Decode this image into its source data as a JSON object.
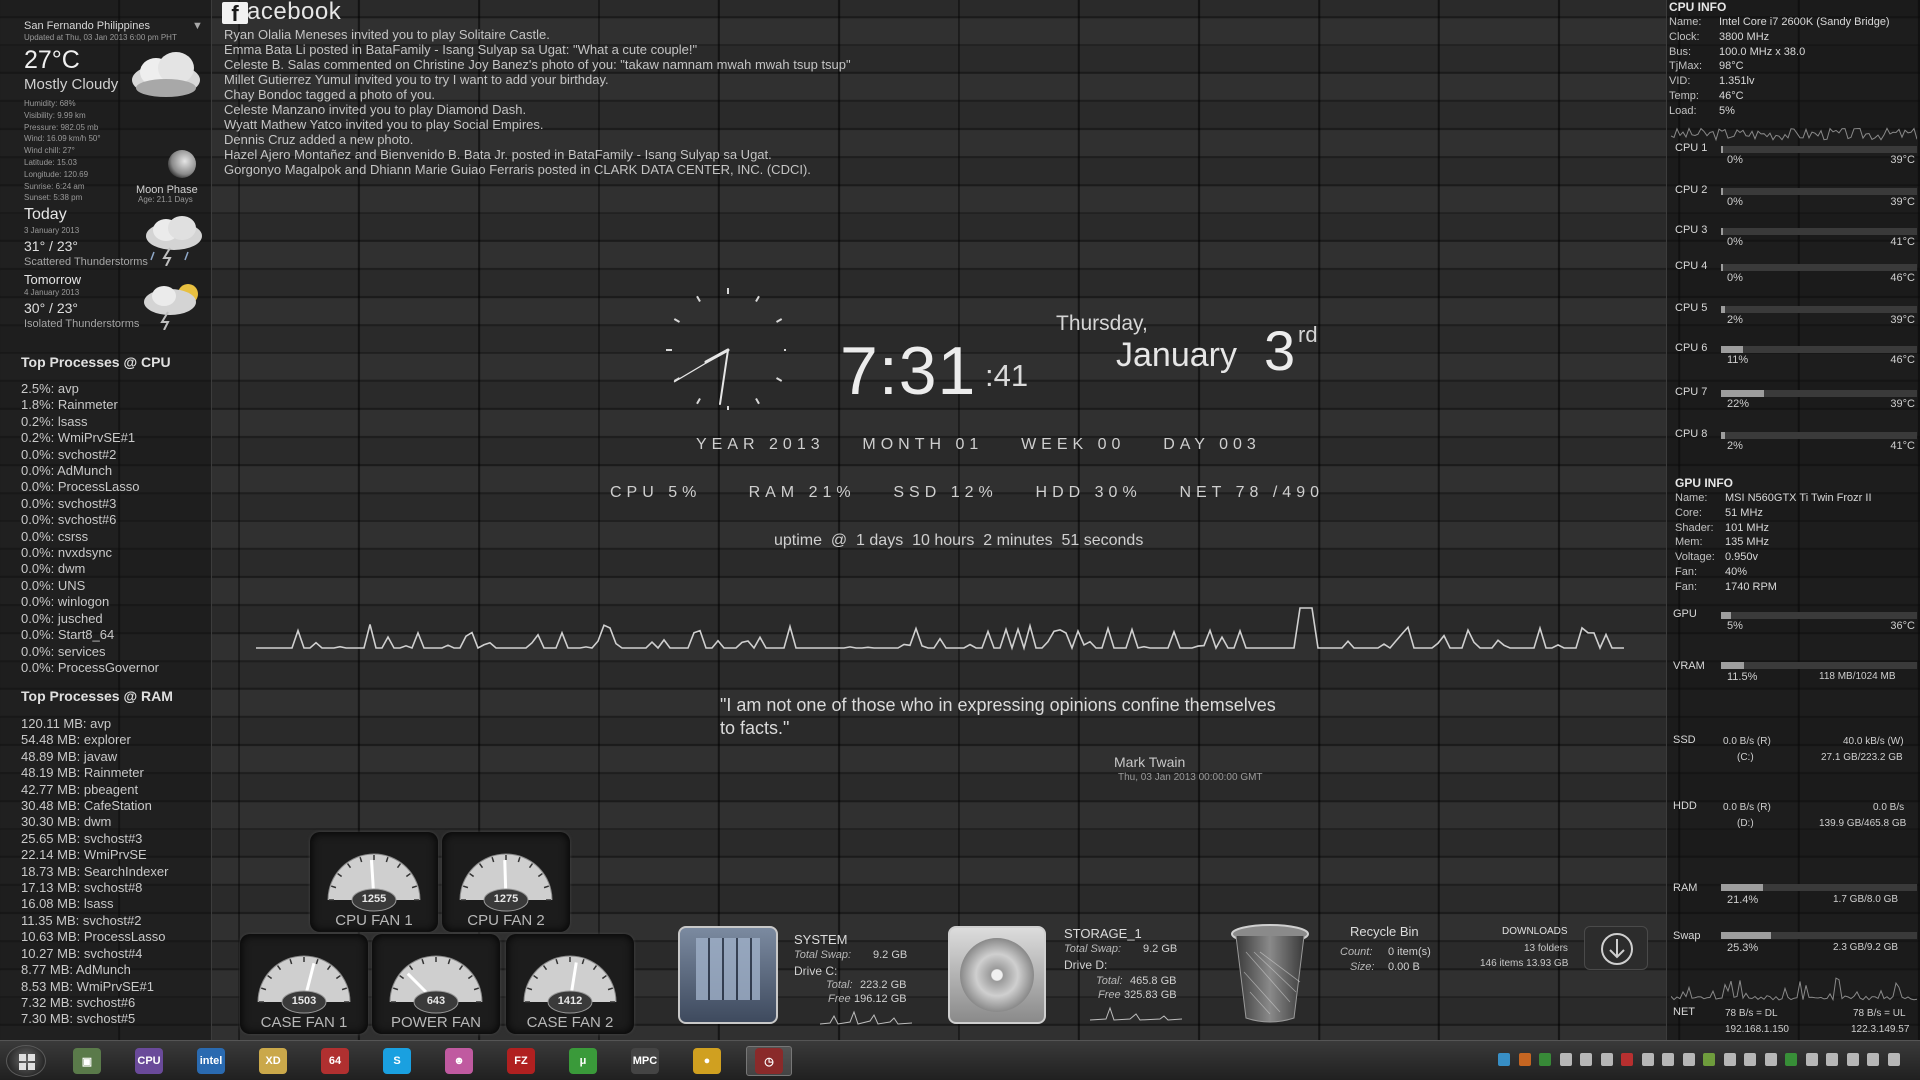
{
  "weather": {
    "location": "San Fernando Philippines",
    "updated": "Updated at Thu, 03 Jan 2013 6:00 pm PHT",
    "temp": "27°C",
    "condition": "Mostly Cloudy",
    "details": [
      "Humidity: 68%",
      "Visibility: 9.99 km",
      "Pressure: 982.05 mb",
      "Wind: 16.09 km/h 50°",
      "Wind chill: 27°",
      "Latitude: 15.03",
      "Longitude: 120.69",
      "Sunrise: 6:24 am",
      "Sunset: 5:38 pm"
    ],
    "moon_label": "Moon Phase",
    "moon_age": "Age: 21.1 Days",
    "today": {
      "name": "Today",
      "date": "3 January 2013",
      "temp": "31° / 23°",
      "cond": "Scattered Thunderstorms"
    },
    "tomorrow": {
      "name": "Tomorrow",
      "date": "4 January 2013",
      "temp": "30° / 23°",
      "cond": "Isolated Thunderstorms"
    }
  },
  "processes": {
    "cpu_title": "Top Processes @ CPU",
    "cpu": [
      "2.5%: avp",
      "1.8%: Rainmeter",
      "0.2%: lsass",
      "0.2%: WmiPrvSE#1",
      "0.0%: svchost#2",
      "0.0%: AdMunch",
      "0.0%: ProcessLasso",
      "0.0%: svchost#3",
      "0.0%: svchost#6",
      "0.0%: csrss",
      "0.0%: nvxdsync",
      "0.0%: dwm",
      "0.0%: UNS",
      "0.0%: winlogon",
      "0.0%: jusched",
      "0.0%: Start8_64",
      "0.0%: services",
      "0.0%: ProcessGovernor"
    ],
    "ram_title": "Top Processes @ RAM",
    "ram": [
      "120.11 MB: avp",
      "54.48 MB: explorer",
      "48.89 MB: javaw",
      "48.19 MB: Rainmeter",
      "42.77 MB: pbeagent",
      "30.48 MB: CafeStation",
      "30.30 MB: dwm",
      "25.65 MB: svchost#3",
      "22.14 MB: WmiPrvSE",
      "18.73 MB: SearchIndexer",
      "17.13 MB: svchost#8",
      "16.08 MB: lsass",
      "11.35 MB: svchost#2",
      "10.63 MB: ProcessLasso",
      "10.27 MB: svchost#4",
      "8.77 MB: AdMunch",
      "8.53 MB: WmiPrvSE#1",
      "7.32 MB: svchost#6",
      "7.30 MB: svchost#5"
    ]
  },
  "facebook": {
    "title": "acebook",
    "logo": "f",
    "feed": [
      "Ryan Olalia Meneses invited you to play Solitaire Castle.",
      "Emma Bata Li posted in BataFamily - Isang Sulyap sa Ugat: \"What a cute couple!\"",
      "Celeste B. Salas commented on Christine Joy Banez's photo of you: \"takaw namnam mwah mwah tsup tsup\"",
      "Millet Gutierrez Yumul invited you to try I want to add your birthday.",
      "Chay Bondoc tagged a photo of you.",
      "Celeste Manzano invited you to play Diamond Dash.",
      "Wyatt Mathew Yatco invited you to play Social Empires.",
      "Dennis Cruz added a new photo.",
      "Hazel Ajero Montañez and Bienvenido B. Bata Jr. posted in BataFamily - Isang Sulyap sa Ugat.",
      "Gorgonyo Magalpok and Dhiann Marie Guiao Ferraris posted in CLARK DATA CENTER, INC. (CDCI)."
    ]
  },
  "clock": {
    "hm": "7:31",
    "sec": ":41",
    "dow": "Thursday,",
    "month": "January",
    "day": "3",
    "suffix": "rd",
    "date_line": "YEAR 2013    MONTH 01    WEEK 00    DAY 003",
    "usage_line": "CPU 5%     RAM 21%    SSD 12%    HDD 30%    NET 78 /490",
    "uptime": "uptime  @  1 days  10 hours  2 minutes  51 seconds"
  },
  "quote": {
    "text": "\"I am not one of those who in expressing opinions confine themselves to facts.\"",
    "author": "Mark Twain",
    "date": "Thu, 03 Jan 2013 00:00:00 GMT"
  },
  "fans": [
    {
      "label": "CPU FAN 1",
      "rpm": "1255",
      "level": 0.48
    },
    {
      "label": "CPU FAN 2",
      "rpm": "1275",
      "level": 0.49
    },
    {
      "label": "CASE FAN 1",
      "rpm": "1503",
      "level": 0.58
    },
    {
      "label": "POWER FAN",
      "rpm": "643",
      "level": 0.25
    },
    {
      "label": "CASE FAN 2",
      "rpm": "1412",
      "level": 0.55
    }
  ],
  "drives": {
    "system": {
      "title": "SYSTEM",
      "swap_label": "Total Swap:",
      "swap": "9.2 GB",
      "drive": "Drive C:",
      "total_label": "Total:",
      "total": "223.2 GB",
      "free_label": "Free",
      "free": "196.12 GB"
    },
    "storage": {
      "title": "STORAGE_1",
      "swap_label": "Total Swap:",
      "swap": "9.2 GB",
      "drive": "Drive D:",
      "total_label": "Total:",
      "total": "465.8 GB",
      "free_label": "Free",
      "free": "325.83 GB"
    },
    "bin": {
      "title": "Recycle Bin",
      "count_label": "Count:",
      "count": "0 item(s)",
      "size_label": "Size:",
      "size": "0.00 B"
    },
    "downloads": {
      "title": "DOWNLOADS",
      "folders": "13 folders",
      "items": "146 items 13.93 GB"
    }
  },
  "cpu_info": {
    "title": "CPU INFO",
    "rows": [
      {
        "k": "Name:",
        "v": "Intel Core i7 2600K (Sandy Bridge)"
      },
      {
        "k": "Clock:",
        "v": "3800 MHz"
      },
      {
        "k": "Bus:",
        "v": "100.0 MHz x 38.0"
      },
      {
        "k": "TjMax:",
        "v": "98°C"
      },
      {
        "k": "VID:",
        "v": "1.351lv"
      },
      {
        "k": "Temp:",
        "v": "46°C"
      },
      {
        "k": "Load:",
        "v": "5%"
      }
    ],
    "cores": [
      {
        "name": "CPU 1",
        "pct": "0%",
        "temp": "39°C",
        "load": 0.0
      },
      {
        "name": "CPU 2",
        "pct": "0%",
        "temp": "39°C",
        "load": 0.0
      },
      {
        "name": "CPU 3",
        "pct": "0%",
        "temp": "41°C",
        "load": 0.0
      },
      {
        "name": "CPU 4",
        "pct": "0%",
        "temp": "46°C",
        "load": 0.0
      },
      {
        "name": "CPU 5",
        "pct": "2%",
        "temp": "39°C",
        "load": 0.02
      },
      {
        "name": "CPU 6",
        "pct": "11%",
        "temp": "46°C",
        "load": 0.11
      },
      {
        "name": "CPU 7",
        "pct": "22%",
        "temp": "39°C",
        "load": 0.22
      },
      {
        "name": "CPU 8",
        "pct": "2%",
        "temp": "41°C",
        "load": 0.02
      }
    ]
  },
  "gpu_info": {
    "title": "GPU INFO",
    "rows": [
      {
        "k": "Name:",
        "v": "MSI N560GTX Ti Twin Frozr II"
      },
      {
        "k": "Core:",
        "v": "51 MHz"
      },
      {
        "k": "Shader:",
        "v": "101 MHz"
      },
      {
        "k": "Mem:",
        "v": "135 MHz"
      },
      {
        "k": "Voltage:",
        "v": "0.950v"
      },
      {
        "k": "Fan:",
        "v": "40%"
      },
      {
        "k": "Fan:",
        "v": "1740 RPM"
      }
    ],
    "gpu": {
      "name": "GPU",
      "pct": "5%",
      "temp": "36°C",
      "load": 0.05
    },
    "vram": {
      "name": "VRAM",
      "pct": "11.5%",
      "val": "118 MB/1024 MB",
      "load": 0.115
    }
  },
  "storage_info": {
    "ssd": {
      "name": "SSD",
      "read": "0.0 B/s (R)",
      "write": "40.0 kB/s (W)",
      "letter": "(C:)",
      "space": "27.1 GB/223.2 GB"
    },
    "hdd": {
      "name": "HDD",
      "read": "0.0 B/s (R)",
      "write": "0.0 B/s",
      "letter": "(D:)",
      "space": "139.9 GB/465.8 GB"
    },
    "ram": {
      "name": "RAM",
      "pct": "21.4%",
      "val": "1.7 GB/8.0 GB",
      "load": 0.214
    },
    "swap": {
      "name": "Swap",
      "pct": "25.3%",
      "val": "2.3 GB/9.2 GB",
      "load": 0.253
    },
    "net": {
      "name": "NET",
      "dl": "78 B/s = DL",
      "ul": "78 B/s = UL",
      "ip1": "192.168.1.150",
      "ip2": "122.3.149.57"
    }
  },
  "taskbar": {
    "apps": [
      {
        "name": "monitor",
        "glyph": "▣",
        "color": "#5a7a4a"
      },
      {
        "name": "cpu-z",
        "glyph": "CPU",
        "color": "#6a4a9a"
      },
      {
        "name": "intel",
        "glyph": "intel",
        "color": "#2a6ab0"
      },
      {
        "name": "xd",
        "glyph": "XD",
        "color": "#caa84a"
      },
      {
        "name": "64",
        "glyph": "64",
        "color": "#b03030"
      },
      {
        "name": "skype",
        "glyph": "S",
        "color": "#1aa0e0"
      },
      {
        "name": "game",
        "glyph": "☻",
        "color": "#c05aa0"
      },
      {
        "name": "filezilla",
        "glyph": "FZ",
        "color": "#b02020"
      },
      {
        "name": "utorrent",
        "glyph": "μ",
        "color": "#3a9a3a"
      },
      {
        "name": "mpc",
        "glyph": "MPC",
        "color": "#444444"
      },
      {
        "name": "chrome",
        "glyph": "●",
        "color": "#d0a020"
      },
      {
        "name": "app-clock",
        "glyph": "◷",
        "color": "#8a2a2a"
      }
    ]
  }
}
